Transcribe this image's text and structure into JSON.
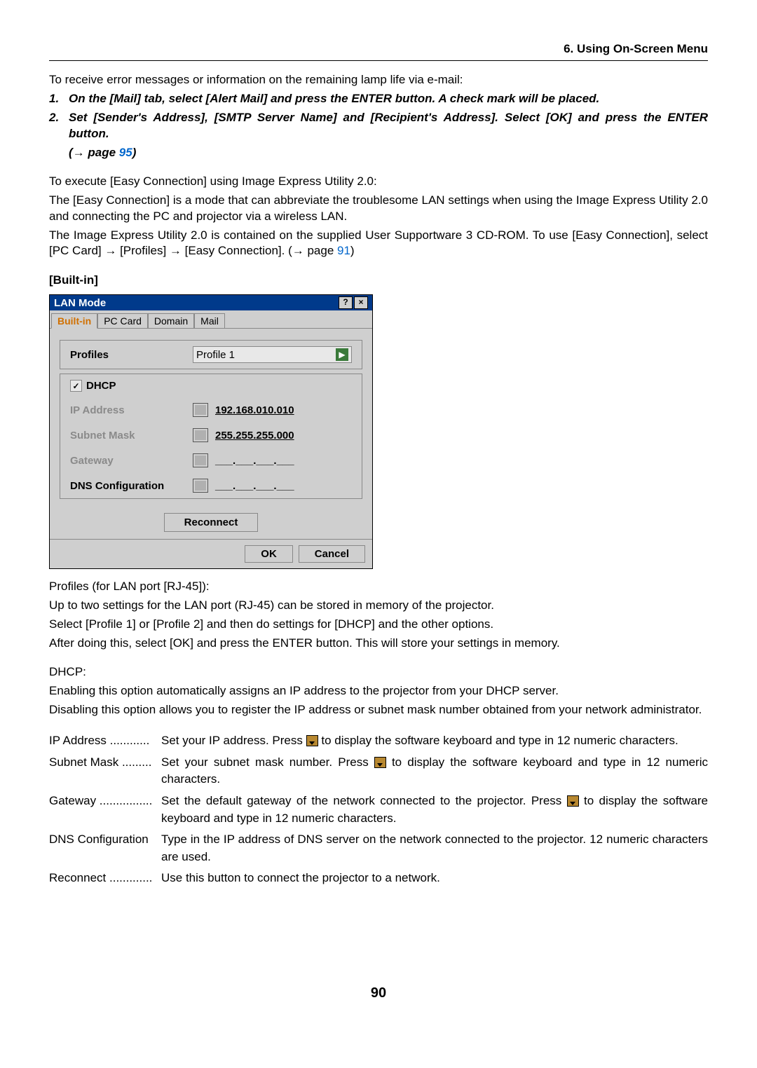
{
  "header": {
    "section_title": "6. Using On-Screen Menu"
  },
  "intro": {
    "line1": "To receive error messages or information on the remaining lamp life via e-mail:",
    "step1": "On the [Mail] tab, select [Alert Mail] and press the ENTER button. A check mark will be placed.",
    "step2": "Set [Sender's Address], [SMTP Server Name] and [Recipient's Address]. Select [OK] and press the ENTER button.",
    "page_ref_prefix": "(→ page ",
    "page_ref_num": "95",
    "page_ref_suffix": ")"
  },
  "easy": {
    "l1": "To execute [Easy Connection] using Image Express Utility 2.0:",
    "l2": "The [Easy Connection] is a mode that can abbreviate the troublesome LAN settings when using the Image Express Utility 2.0 and connecting the PC and projector via a wireless LAN.",
    "l3a": "The Image Express Utility 2.0 is contained on the supplied User Supportware 3 CD-ROM. To use [Easy Connection], select [PC Card] → [Profiles] → [Easy Connection]. (→ page ",
    "l3b": "91",
    "l3c": ")"
  },
  "builtin_head": "[Built-in]",
  "dialog": {
    "title": "LAN Mode",
    "tabs": {
      "t1": "Built-in",
      "t2": "PC Card",
      "t3": "Domain",
      "t4": "Mail"
    },
    "labels": {
      "profiles": "Profiles",
      "dhcp": "DHCP",
      "ip": "IP Address",
      "subnet": "Subnet Mask",
      "gateway": "Gateway",
      "dns": "DNS Configuration"
    },
    "values": {
      "profile": "Profile 1",
      "ip": "192.168.010.010",
      "subnet": "255.255.255.000",
      "blank": "___.___.___.___",
      "check": "✓"
    },
    "buttons": {
      "reconnect": "Reconnect",
      "ok": "OK",
      "cancel": "Cancel"
    }
  },
  "profiles_block": {
    "l1": "Profiles (for LAN port [RJ-45]):",
    "l2": "Up to two settings for the LAN port (RJ-45) can be stored in memory of the projector.",
    "l3": "Select [Profile 1] or [Profile 2] and then do settings for [DHCP] and the other options.",
    "l4": "After doing this, select [OK] and press the ENTER button. This will store your settings in memory."
  },
  "dhcp_block": {
    "l1": "DHCP:",
    "l2": "Enabling this option automatically assigns an IP address to the projector from your DHCP server.",
    "l3": "Disabling this option allows you to register the IP address or subnet mask number obtained from your network administrator."
  },
  "defs": {
    "ip_t": "IP Address ............",
    "ip_d1": "Set your IP address. Press ",
    "ip_d2": " to display the software keyboard and type in 12 numeric characters.",
    "sm_t": "Subnet Mask .........",
    "sm_d1": "Set your subnet mask number. Press ",
    "sm_d2": " to display the software keyboard and type in 12 numeric characters.",
    "gw_t": "Gateway ................",
    "gw_d1": "Set the default gateway of the network connected to the projector. Press ",
    "gw_d2": " to display the software keyboard and type in 12 numeric characters.",
    "dns_t": "DNS Configuration",
    "dns_d": "Type in the IP address of DNS server on the network connected to the projector. 12 numeric characters are used.",
    "rc_t": "Reconnect .............",
    "rc_d": "Use this button to connect the projector to a network."
  },
  "page_number": "90"
}
